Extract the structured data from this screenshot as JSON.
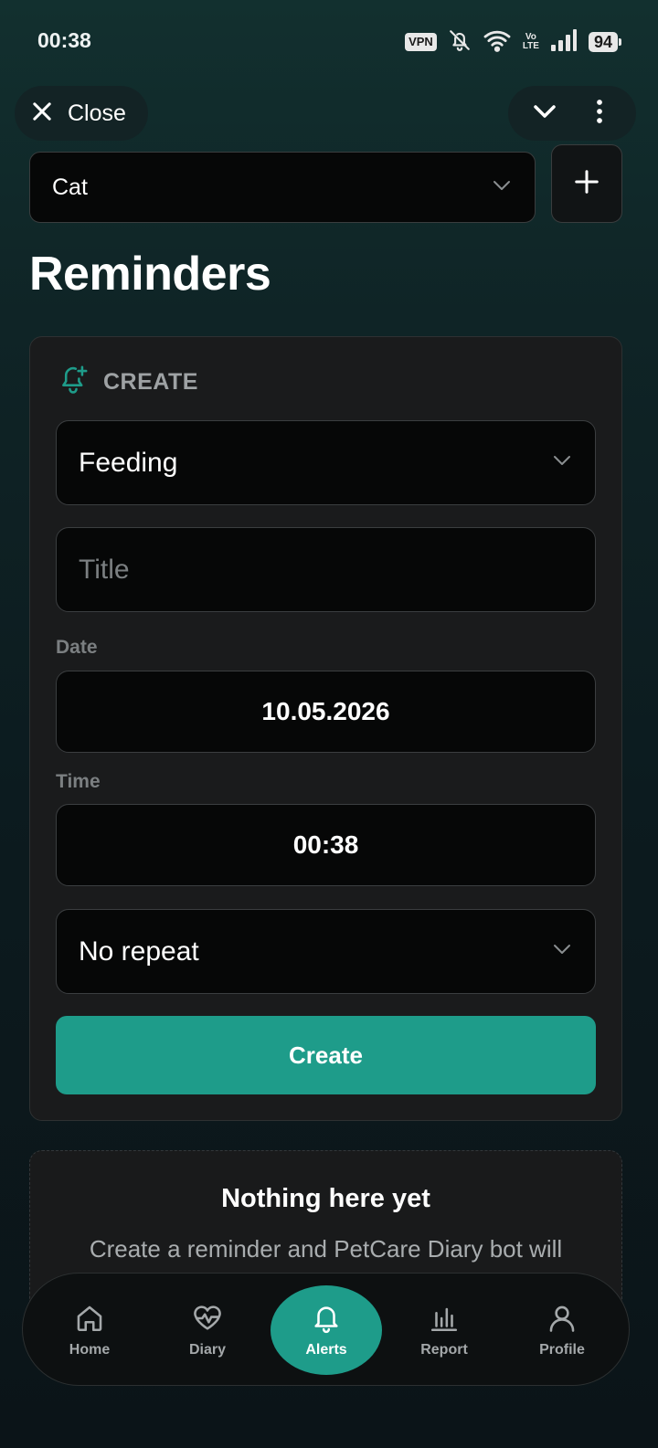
{
  "status_bar": {
    "time": "00:38",
    "vpn": "VPN",
    "volte_top": "Vo",
    "volte_bottom": "LTE",
    "battery": "94",
    "icons": [
      "vpn-icon",
      "bell-off-icon",
      "wifi-icon",
      "volte-icon",
      "signal-icon",
      "battery-icon"
    ]
  },
  "header": {
    "close_label": "Close",
    "chevron_icon": "chevron-down-icon",
    "menu_icon": "more-vertical-icon"
  },
  "pet_selector": {
    "value": "Cat",
    "add_icon": "plus-icon"
  },
  "page_title": "Reminders",
  "create_card": {
    "header_label": "CREATE",
    "header_icon": "bell-plus-icon",
    "type_value": "Feeding",
    "title_placeholder": "Title",
    "date_label": "Date",
    "date_value": "10.05.2026",
    "time_label": "Time",
    "time_value": "00:38",
    "repeat_value": "No repeat",
    "submit_label": "Create"
  },
  "empty_state": {
    "title": "Nothing here yet",
    "description": "Create a reminder and PetCare Diary bot will"
  },
  "bottom_nav": {
    "items": [
      {
        "label": "Home",
        "icon": "home-icon",
        "active": false
      },
      {
        "label": "Diary",
        "icon": "heart-pulse-icon",
        "active": false
      },
      {
        "label": "Alerts",
        "icon": "bell-icon",
        "active": true
      },
      {
        "label": "Report",
        "icon": "bar-chart-icon",
        "active": false
      },
      {
        "label": "Profile",
        "icon": "user-icon",
        "active": false
      }
    ]
  },
  "colors": {
    "accent": "#1e9c8a",
    "background_top": "#12302f",
    "background_bottom": "#0b1418",
    "card": "#1a1b1c",
    "field": "#060707"
  }
}
